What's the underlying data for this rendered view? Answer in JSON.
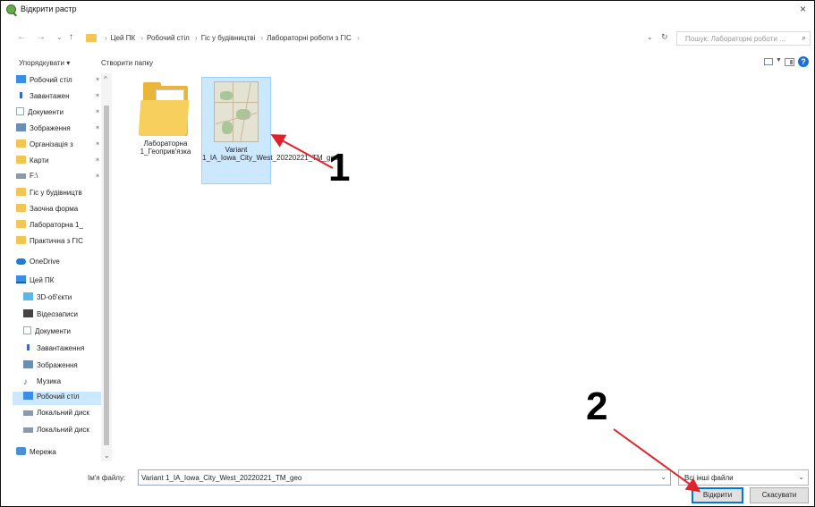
{
  "window": {
    "title": "Відкрити растр",
    "close_glyph": "×"
  },
  "address_bar": {
    "back": "←",
    "forward": "→",
    "recent": "⌄",
    "up": "↑",
    "crumbs": [
      "Цей ПК",
      "Робочий стіл",
      "Гіс у будівництві",
      "Лабораторні роботи з ГІС"
    ],
    "search_placeholder": "Пошук: Лабораторні роботи ...",
    "search_glyph": "⌕",
    "refresh_glyph": "↻",
    "dropdown_glyph": "⌄"
  },
  "toolbar": {
    "organize": "Упорядкувати ▾",
    "new_folder": "Створити папку",
    "help": "?"
  },
  "nav_pane": {
    "items": [
      {
        "label": "Робочий стіл",
        "icon": "desktop-icon",
        "pinned": true
      },
      {
        "label": "Завантажен",
        "icon": "download-icon",
        "pinned": true
      },
      {
        "label": "Документи",
        "icon": "document-icon",
        "pinned": true
      },
      {
        "label": "Зображення",
        "icon": "pictures-icon",
        "pinned": true
      },
      {
        "label": "Організація з",
        "icon": "folder-icon",
        "pinned": true
      },
      {
        "label": "Карти",
        "icon": "folder-icon",
        "pinned": true
      },
      {
        "label": "F:\\",
        "icon": "drive-icon",
        "pinned": true
      },
      {
        "label": "Гіс у будівництв",
        "icon": "folder-icon",
        "pinned": false
      },
      {
        "label": "Заочна форма",
        "icon": "folder-icon",
        "pinned": false
      },
      {
        "label": "Лабораторна 1_",
        "icon": "folder-icon",
        "pinned": false
      },
      {
        "label": "Практична з ГІС",
        "icon": "folder-icon",
        "pinned": false
      },
      {
        "label": "OneDrive",
        "icon": "onedrive-icon",
        "pinned": false
      },
      {
        "label": "Цей ПК",
        "icon": "this-pc-icon",
        "pinned": false
      },
      {
        "label": "3D-об'єкти",
        "icon": "objects-3d-icon",
        "pinned": false
      },
      {
        "label": "Відеозаписи",
        "icon": "videos-icon",
        "pinned": false
      },
      {
        "label": "Документи",
        "icon": "document-icon",
        "pinned": false
      },
      {
        "label": "Завантаження",
        "icon": "download-icon",
        "pinned": false
      },
      {
        "label": "Зображення",
        "icon": "pictures-icon",
        "pinned": false
      },
      {
        "label": "Музика",
        "icon": "music-icon",
        "pinned": false
      },
      {
        "label": "Робочий стіл",
        "icon": "desktop-icon",
        "pinned": false,
        "selected": true
      },
      {
        "label": "Локальний диск",
        "icon": "drive-icon",
        "pinned": false
      },
      {
        "label": "Локальний диск",
        "icon": "drive-icon",
        "pinned": false
      },
      {
        "label": "Мережа",
        "icon": "network-icon",
        "pinned": false
      }
    ],
    "pin_glyph": "✶",
    "scroll_up": "^",
    "scroll_down": "⌄"
  },
  "files": [
    {
      "name": "Лабораторна 1_Геоприв'язка",
      "icon": "folder-icon"
    },
    {
      "name": "Variant 1_IA_Iowa_City_West_20220221_TM_geo",
      "icon": "raster-map-thumbnail",
      "selected": true
    }
  ],
  "bottom": {
    "filename_label": "Ім'я файлу:",
    "filename_value": "Variant 1_IA_Iowa_City_West_20220221_TM_geo",
    "filter_value": "Всі інші файли",
    "open_label": "Відкрити",
    "cancel_label": "Скасувати"
  },
  "annotations": [
    {
      "label": "1"
    },
    {
      "label": "2"
    }
  ],
  "colors": {
    "selection": "#cce8ff",
    "accent": "#0078d7",
    "annotation_arrow": "#e0232a"
  }
}
